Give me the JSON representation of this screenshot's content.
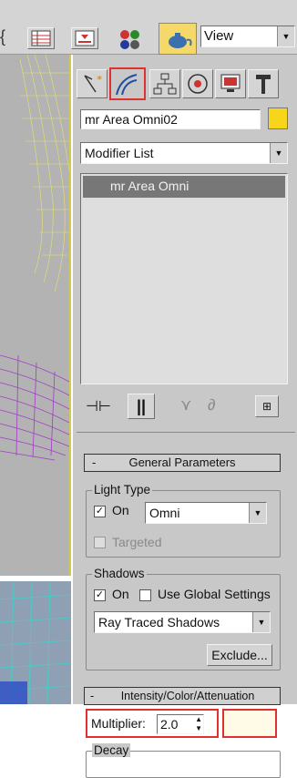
{
  "toolbar": {
    "view_label": "View",
    "icons": [
      "curly-brace-icon",
      "list-icon",
      "import-icon",
      "material-icon",
      "teapot-render-icon"
    ]
  },
  "panel_tabs": [
    "create-tab",
    "modify-tab",
    "hierarchy-tab",
    "motion-tab",
    "display-tab",
    "utilities-tab"
  ],
  "object": {
    "name": "mr Area Omni02",
    "color": "#f7d51a"
  },
  "modifier_list": {
    "label": "Modifier List"
  },
  "stack": {
    "items": [
      "mr Area Omni"
    ]
  },
  "general_parameters": {
    "title": "General Parameters",
    "light_type": {
      "title": "Light Type",
      "on_label": "On",
      "on_checked": true,
      "type_value": "Omni",
      "targeted_label": "Targeted",
      "targeted_checked": false
    },
    "shadows": {
      "title": "Shadows",
      "on_label": "On",
      "on_checked": true,
      "global_label": "Use Global Settings",
      "global_checked": false,
      "type_value": "Ray Traced Shadows",
      "exclude_label": "Exclude..."
    }
  },
  "intensity": {
    "title": "Intensity/Color/Attenuation",
    "multiplier_label": "Multiplier:",
    "multiplier_value": "2.0",
    "color": "#fffbe6"
  },
  "decay": {
    "title": "Decay"
  },
  "colors": {
    "highlight": "#e0302f",
    "panel": "#c8c8c8",
    "viewport_border": "#d8c84a"
  }
}
